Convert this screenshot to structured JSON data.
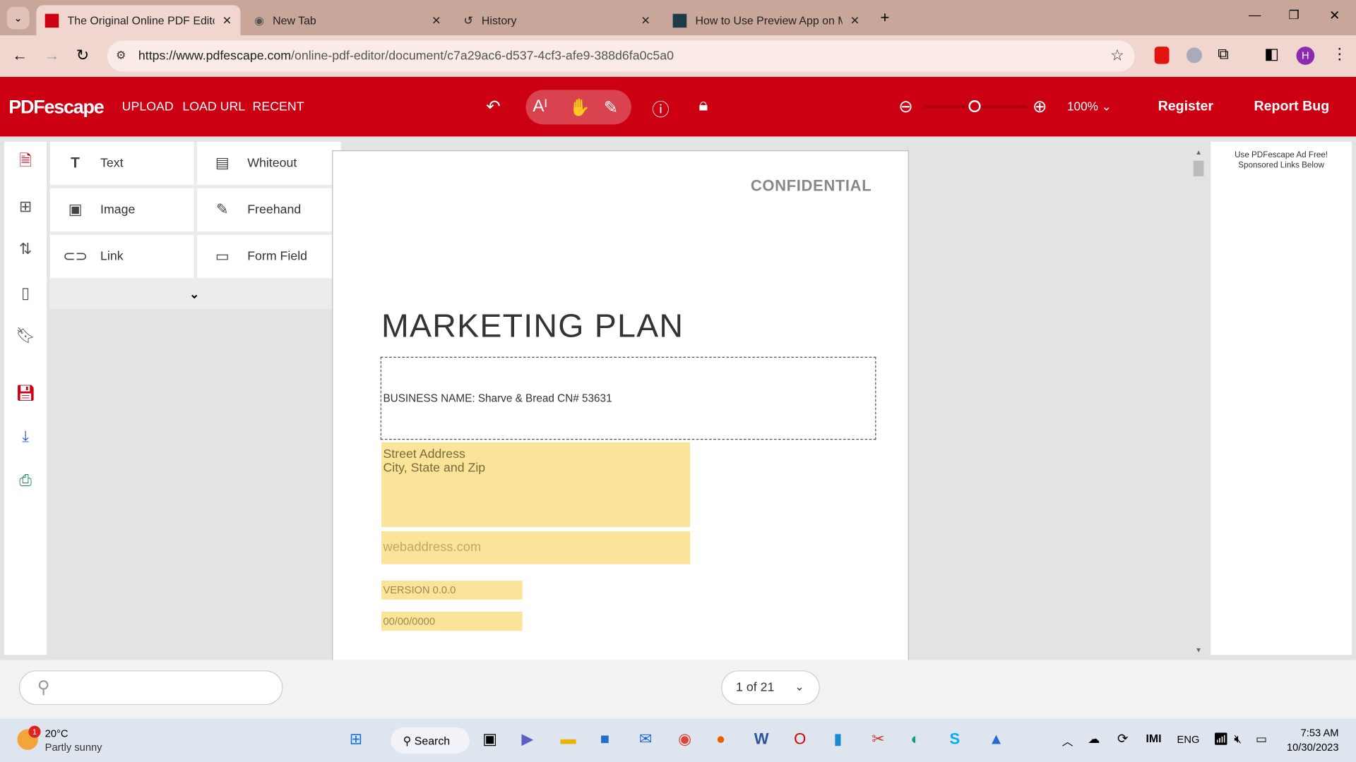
{
  "browser": {
    "tabs": [
      {
        "title": "The Original Online PDF Editor",
        "active": true
      },
      {
        "title": "New Tab"
      },
      {
        "title": "History"
      },
      {
        "title": "How to Use Preview App on M"
      }
    ],
    "url_host": "https://www.pdfescape.com",
    "url_path": "/online-pdf-editor/document/c7a29ac6-d537-4cf3-afe9-388d6fa0c5a0",
    "profile_initial": "H"
  },
  "app": {
    "logo": "PDFescape",
    "nav": [
      "UPLOAD",
      "LOAD URL",
      "RECENT"
    ],
    "zoom": "100%",
    "zoom_level_fraction": 0.5,
    "register": "Register",
    "report_bug": "Report Bug",
    "brand_color": "#cc0012"
  },
  "tools": [
    {
      "label": "Text",
      "icon": "text-icon"
    },
    {
      "label": "Whiteout",
      "icon": "whiteout-icon"
    },
    {
      "label": "Image",
      "icon": "image-icon"
    },
    {
      "label": "Freehand",
      "icon": "pencil-icon"
    },
    {
      "label": "Link",
      "icon": "link-icon"
    },
    {
      "label": "Form Field",
      "icon": "form-field-icon"
    }
  ],
  "document": {
    "confidential": "CONFIDENTIAL",
    "title": "MARKETING PLAN",
    "business": "BUSINESS NAME: Sharve & Bread CN# 53631",
    "street": "Street Address",
    "city": "City, State and Zip",
    "web": "webaddress.com",
    "version": "VERSION 0.0.0",
    "date": "00/00/0000"
  },
  "ad": {
    "line1": "Use PDFescape Ad Free!",
    "line2": "Sponsored Links Below"
  },
  "footer": {
    "search_placeholder": "",
    "page": "1 of 21"
  },
  "taskbar": {
    "weather_temp": "20°C",
    "weather_desc": "Partly sunny",
    "weather_badge": "1",
    "search": "Search",
    "lang": "ENG",
    "time": "7:53 AM",
    "date": "10/30/2023"
  }
}
